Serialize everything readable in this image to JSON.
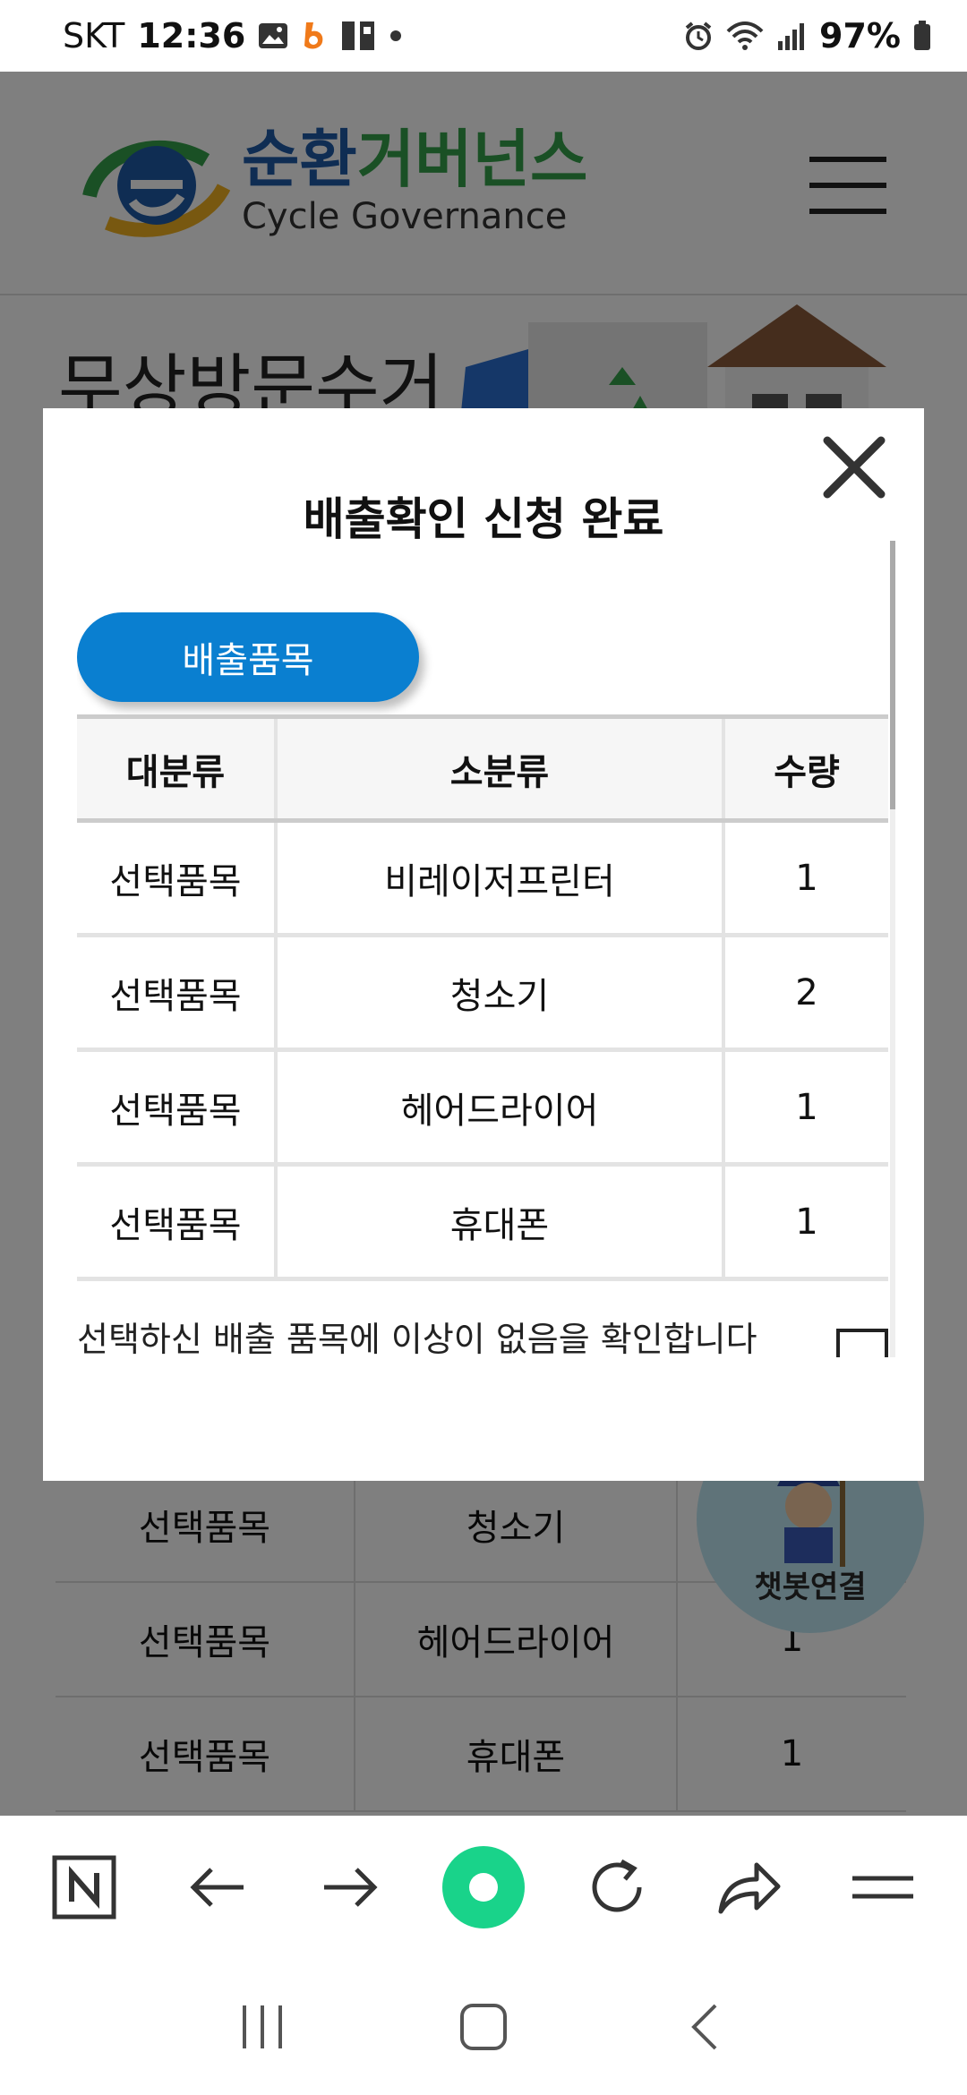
{
  "status_bar": {
    "carrier": "SKT",
    "time": "12:36",
    "battery": "97%",
    "icons": [
      "image-icon",
      "b-app-icon",
      "sim-icon",
      "dot-icon",
      "alarm-icon",
      "wifi-icon",
      "signal-icon",
      "battery-icon"
    ]
  },
  "header": {
    "logo_ko_part1": "순환",
    "logo_ko_part2": "거버넌스",
    "logo_en": "Cycle Governance",
    "menu_icon": "hamburger-icon"
  },
  "banner": {
    "title": "무상방문수거"
  },
  "modal": {
    "title": "배출확인 신청 완료",
    "close_icon": "close-icon",
    "category_pill": "배출품목",
    "table": {
      "headers": [
        "대분류",
        "소분류",
        "수량"
      ],
      "rows": [
        [
          "선택품목",
          "비레이저프린터",
          "1"
        ],
        [
          "선택품목",
          "청소기",
          "2"
        ],
        [
          "선택품목",
          "헤어드라이어",
          "1"
        ],
        [
          "선택품목",
          "휴대폰",
          "1"
        ]
      ]
    },
    "confirm_text": "선택하신 배출 품목에 이상이 없음을 확인합니다"
  },
  "background_table": {
    "rows": [
      [
        "선택품목",
        "청소기",
        ""
      ],
      [
        "선택품목",
        "헤어드라이어",
        "1"
      ],
      [
        "선택품목",
        "휴대폰",
        "1"
      ]
    ]
  },
  "chatbot": {
    "label": "챗봇연결"
  },
  "browser_toolbar": {
    "buttons": [
      "naver-n-icon",
      "back-arrow-icon",
      "forward-arrow-icon",
      "home-green-icon",
      "refresh-icon",
      "share-icon",
      "menu-icon"
    ]
  },
  "system_nav": {
    "buttons": [
      "recent-apps-icon",
      "home-icon",
      "back-icon"
    ]
  },
  "colors": {
    "pill_blue": "#0a7fd0",
    "logo_blue": "#1f5aa6",
    "logo_green": "#35a04a",
    "home_green": "#19d38a"
  }
}
